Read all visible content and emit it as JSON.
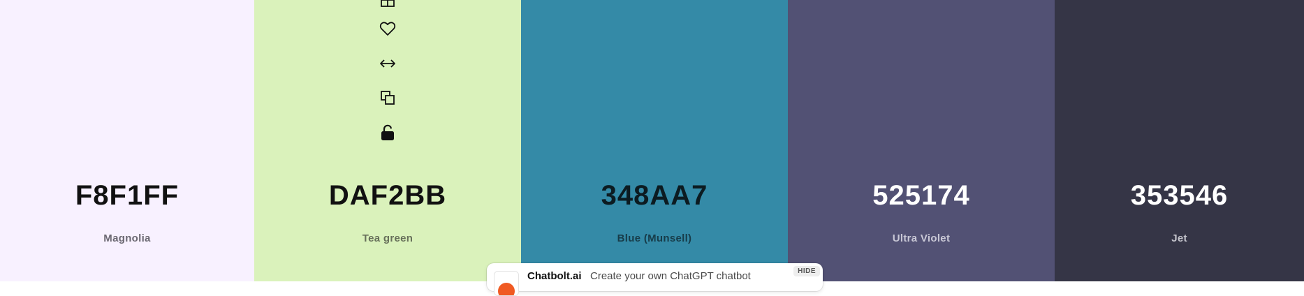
{
  "palette": {
    "colors": [
      {
        "hex": "F8F1FF",
        "name": "Magnolia",
        "bg": "#F8F1FF",
        "hex_color": "#111111",
        "name_color": "#6b6872"
      },
      {
        "hex": "DAF2BB",
        "name": "Tea green",
        "bg": "#DAF2BB",
        "hex_color": "#111111",
        "name_color": "#67705a"
      },
      {
        "hex": "348AA7",
        "name": "Blue (Munsell)",
        "bg": "#348AA7",
        "hex_color": "#0c1b21",
        "name_color": "#173c49"
      },
      {
        "hex": "525174",
        "name": "Ultra Violet",
        "bg": "#525174",
        "hex_color": "#ffffff",
        "name_color": "#c9c8d6"
      },
      {
        "hex": "353546",
        "name": "Jet",
        "bg": "#353546",
        "hex_color": "#ffffff",
        "name_color": "#c4c4cc"
      }
    ],
    "swatch_tools": {
      "icons": [
        "view-shades-icon",
        "heart-icon",
        "drag-arrows-icon",
        "copy-icon",
        "unlock-icon"
      ]
    }
  },
  "ad": {
    "brand": "Chatbolt.ai",
    "text": "Create your own ChatGPT chatbot",
    "hide_label": "HIDE",
    "logo_color": "#F05A22"
  }
}
